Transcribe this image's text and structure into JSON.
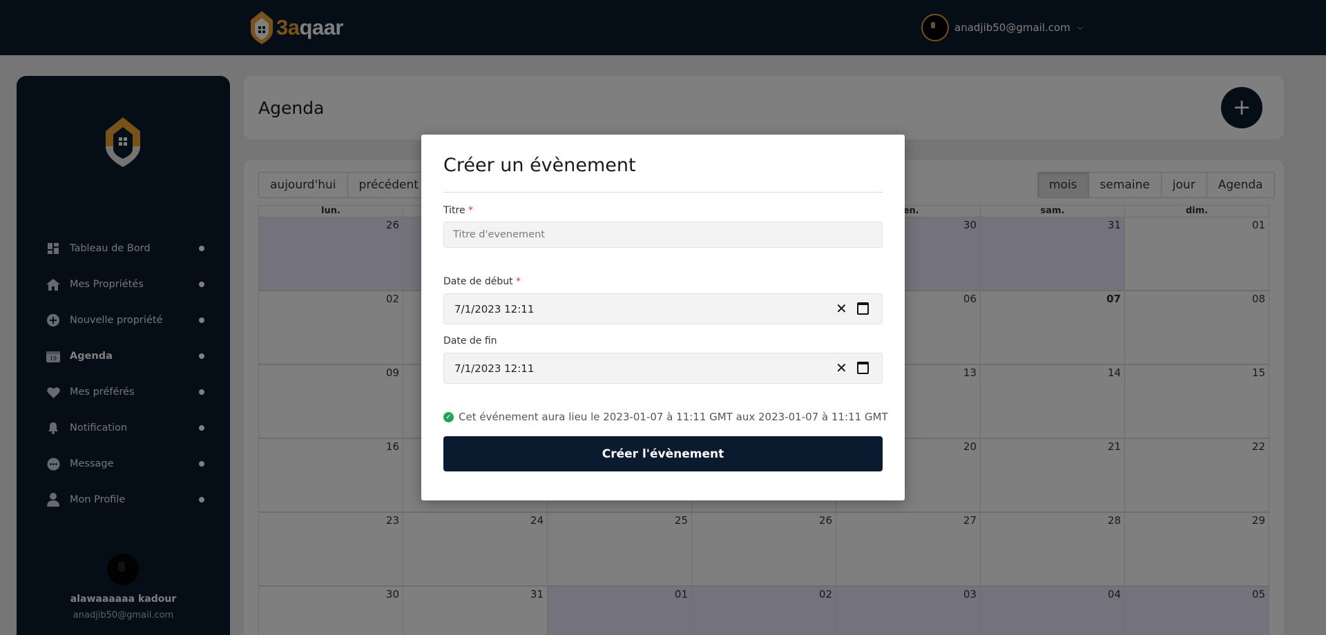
{
  "topbar": {
    "logo_prefix": "3a",
    "logo_suffix": "qaar",
    "user_email": "anadjib50@gmail.com"
  },
  "sidebar": {
    "items": [
      {
        "label": "Tableau de Bord",
        "icon": "dashboard-icon",
        "active": false
      },
      {
        "label": "Mes Propriétés",
        "icon": "home-icon",
        "active": false
      },
      {
        "label": "Nouvelle propriété",
        "icon": "plus-circle-icon",
        "active": false
      },
      {
        "label": "Agenda",
        "icon": "calendar-icon",
        "active": true
      },
      {
        "label": "Mes préférés",
        "icon": "heart-icon",
        "active": false
      },
      {
        "label": "Notification",
        "icon": "bell-icon",
        "active": false
      },
      {
        "label": "Message",
        "icon": "chat-icon",
        "active": false
      },
      {
        "label": "Mon Profile",
        "icon": "user-icon",
        "active": false
      }
    ],
    "user_name": "alawaaaaaa kadour",
    "user_email": "anadjib50@gmail.com"
  },
  "header": {
    "title": "Agenda",
    "add_label": "+"
  },
  "calendar": {
    "nav_buttons": [
      "aujourd'hui",
      "précédent"
    ],
    "view_buttons": [
      "mois",
      "semaine",
      "jour",
      "Agenda"
    ],
    "active_view": "mois",
    "weekdays": [
      "lun.",
      "",
      "",
      "",
      "ven.",
      "sam.",
      "dim."
    ],
    "weeks": [
      [
        {
          "d": "26",
          "off": true
        },
        {
          "d": "",
          "off": true
        },
        {
          "d": "",
          "off": true
        },
        {
          "d": "",
          "off": true
        },
        {
          "d": "30",
          "off": true
        },
        {
          "d": "31",
          "off": true
        },
        {
          "d": "01",
          "off": false
        }
      ],
      [
        {
          "d": "02",
          "off": false
        },
        {
          "d": "",
          "off": false
        },
        {
          "d": "",
          "off": false
        },
        {
          "d": "",
          "off": false
        },
        {
          "d": "06",
          "off": false
        },
        {
          "d": "07",
          "off": false,
          "today": true
        },
        {
          "d": "08",
          "off": false
        }
      ],
      [
        {
          "d": "09",
          "off": false
        },
        {
          "d": "",
          "off": false
        },
        {
          "d": "",
          "off": false
        },
        {
          "d": "",
          "off": false
        },
        {
          "d": "13",
          "off": false
        },
        {
          "d": "14",
          "off": false
        },
        {
          "d": "15",
          "off": false
        }
      ],
      [
        {
          "d": "16",
          "off": false
        },
        {
          "d": "",
          "off": false
        },
        {
          "d": "",
          "off": false
        },
        {
          "d": "",
          "off": false
        },
        {
          "d": "20",
          "off": false
        },
        {
          "d": "21",
          "off": false
        },
        {
          "d": "22",
          "off": false
        }
      ],
      [
        {
          "d": "23",
          "off": false
        },
        {
          "d": "24",
          "off": false
        },
        {
          "d": "25",
          "off": false
        },
        {
          "d": "26",
          "off": false
        },
        {
          "d": "27",
          "off": false
        },
        {
          "d": "28",
          "off": false
        },
        {
          "d": "29",
          "off": false
        }
      ],
      [
        {
          "d": "30",
          "off": false
        },
        {
          "d": "31",
          "off": false
        },
        {
          "d": "01",
          "off": true
        },
        {
          "d": "02",
          "off": true
        },
        {
          "d": "03",
          "off": true
        },
        {
          "d": "04",
          "off": true
        },
        {
          "d": "05",
          "off": true
        }
      ]
    ]
  },
  "modal": {
    "title": "Créer un évènement",
    "title_label": "Titre",
    "title_placeholder": "Titre d'evenement",
    "start_label": "Date de début",
    "start_value": "7/1/2023 12:11",
    "end_label": "Date de fin",
    "end_value": "7/1/2023 12:11",
    "required_mark": "*",
    "info_text": "Cet événement aura lieu le 2023-01-07 à 11:11 GMT aux 2023-01-07 à 11:11 GMT",
    "submit_label": "Créer l'évènement"
  },
  "colors": {
    "navy": "#0b1b2f",
    "accent": "#f0a531",
    "success": "#23a559"
  }
}
